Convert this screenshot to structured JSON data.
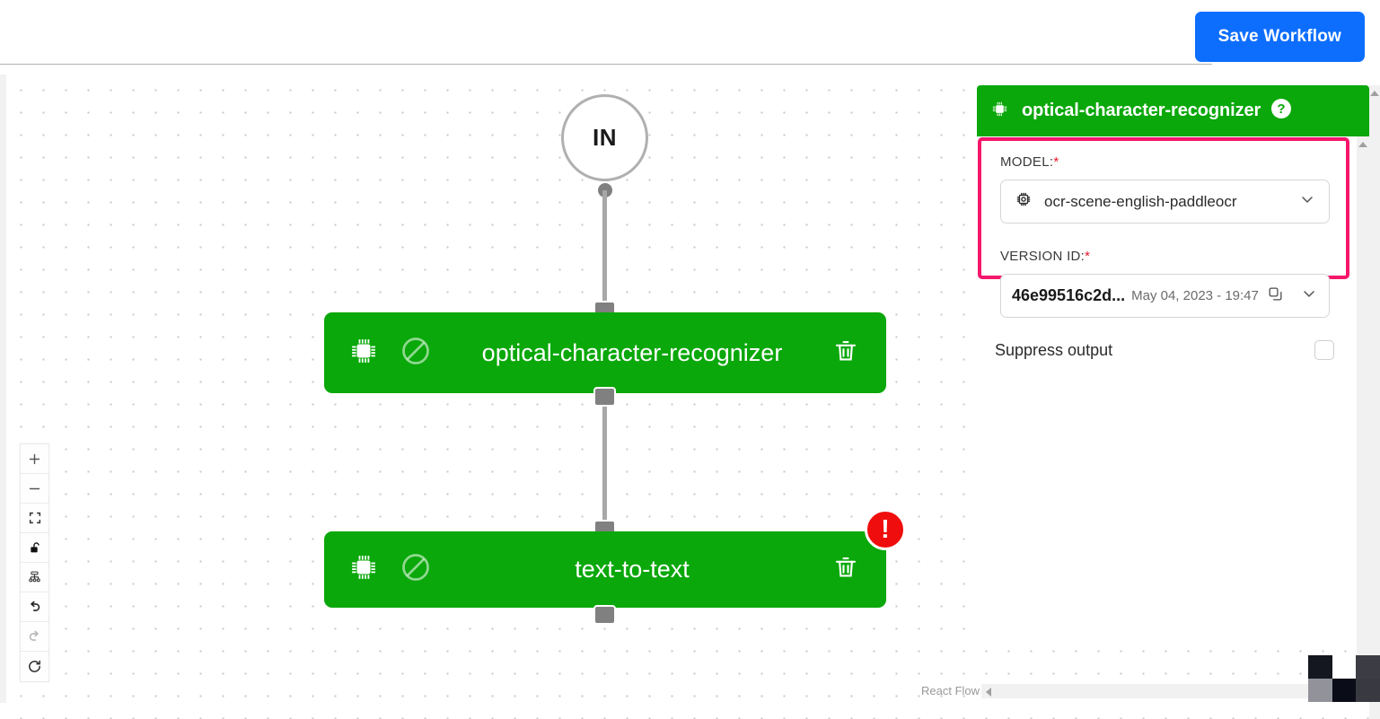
{
  "topbar": {
    "save_label": "Save Workflow"
  },
  "canvas": {
    "in_node_label": "IN",
    "attribution": "React Flow",
    "nodes": [
      {
        "label": "optical-character-recognizer",
        "chip_icon": "chip-icon",
        "disable_icon": "disable-icon",
        "delete_icon": "trash-icon",
        "has_error": false
      },
      {
        "label": "text-to-text",
        "chip_icon": "chip-icon",
        "disable_icon": "disable-icon",
        "delete_icon": "trash-icon",
        "has_error": true,
        "error_mark": "!"
      }
    ],
    "controls": [
      {
        "name": "zoom-in-button",
        "icon": "plus-icon"
      },
      {
        "name": "zoom-out-button",
        "icon": "minus-icon"
      },
      {
        "name": "fit-view-button",
        "icon": "fit-view-icon"
      },
      {
        "name": "lock-toggle-button",
        "icon": "unlock-icon"
      },
      {
        "name": "auto-layout-button",
        "icon": "hierarchy-icon"
      },
      {
        "name": "undo-button",
        "icon": "undo-arrow-icon"
      },
      {
        "name": "redo-button",
        "icon": "redo-arrow-icon"
      },
      {
        "name": "reset-button",
        "icon": "refresh-icon"
      }
    ]
  },
  "panel": {
    "title": "optical-character-recognizer",
    "header_icon": "chip-icon",
    "help_icon": "help-circle-icon",
    "model": {
      "label": "MODEL:",
      "required_mark": "*",
      "value": "ocr-scene-english-paddleocr",
      "icon": "chip-icon",
      "chevron": "chevron-down-icon"
    },
    "version": {
      "label": "VERSION ID:",
      "required_mark": "*",
      "id": "46e99516c2d...",
      "date": "May 04, 2023 - 19:47",
      "copy_icon": "copy-icon",
      "chevron": "chevron-down-icon"
    },
    "suppress": {
      "label": "Suppress output",
      "checked": false
    },
    "highlight_color": "#f5176b"
  },
  "colors": {
    "node_green": "#0aa80a",
    "accent_blue": "#0d6efd",
    "error_red": "#f00d0d",
    "highlight_pink": "#f5176b"
  },
  "corner_blocks": [
    "#141720",
    "#ffffff",
    "#3c3d44",
    "#92939a",
    "#0a0d17",
    "#393a41"
  ]
}
